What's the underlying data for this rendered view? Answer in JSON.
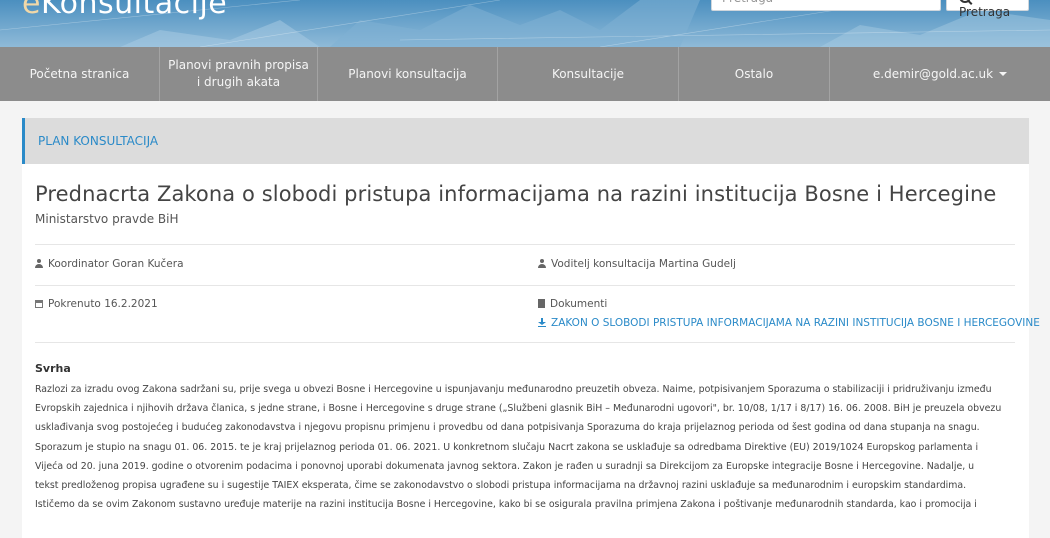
{
  "header": {
    "logo_prefix": "e",
    "logo_main": "Konsultacije",
    "search_placeholder": "Pretraga",
    "search_button": "Pretraga"
  },
  "nav": [
    {
      "label": "Početna stranica"
    },
    {
      "label": "Planovi pravnih propisa i drugih akata"
    },
    {
      "label": "Planovi konsultacija"
    },
    {
      "label": "Konsultacije"
    },
    {
      "label": "Ostalo"
    },
    {
      "label": "e.demir@gold.ac.uk"
    }
  ],
  "card": {
    "section_label": "PLAN KONSULTACIJA",
    "title": "Prednacrta Zakona o slobodi pristupa informacijama na razini institucija Bosne i Hercegine",
    "subtitle": "Ministarstvo pravde BiH",
    "coordinator": "Koordinator Goran Kučera",
    "leader": "Voditelj konsultacija Martina Gudelj",
    "started": "Pokrenuto 16.2.2021",
    "documents_label": "Dokumenti",
    "document_link": "ZAKON O SLOBODI PRISTUPA INFORMACIJAMA NA RAZINI INSTITUCIJA BOSNE I HERCEGOVINE",
    "purpose_heading": "Svrha",
    "purpose_lines": [
      "Razlozi za izradu ovog Zakona sadržani su, prije svega u obvezi Bosne i Hercegovine u ispunjavanju međunarodno preuzetih obveza. Naime, potpisivanjem Sporazuma o stabilizaciji i pridruživanju između",
      "Evropskih zajednica i njihovih država članica, s jedne strane, i Bosne i Hercegovine s druge strane („Službeni glasnik BiH – Međunarodni ugovori\", br. 10/08, 1/17 i 8/17) 16. 06. 2008. BiH je preuzela obvezu",
      "usklađivanja svog postojećeg i budućeg zakonodavstva i njegovu propisnu primjenu i provedbu od dana potpisivanja Sporazuma do kraja prijelaznog perioda od šest godina od dana stupanja na snagu.",
      "Sporazum je stupio na snagu 01. 06. 2015. te je kraj prijelaznog perioda 01. 06. 2021. U konkretnom slučaju Nacrt zakona se usklađuje sa odredbama Direktive (EU) 2019/1024 Europskog parlamenta i",
      "Vijeća od 20. juna 2019. godine o otvorenim podacima i ponovnoj uporabi dokumenata javnog sektora. Zakon je rađen u suradnji sa Direkcijom za Europske integracije Bosne i Hercegovine. Nadalje, u",
      "tekst predloženog propisa ugrađene su i sugestije TAIEX eksperata, čime se zakonodavstvo o slobodi pristupa informacijama na državnoj razini usklađuje sa međunarodnim i europskim standardima.",
      "Ističemo da se ovim Zakonom sustavno uređuje materije na razini institucija Bosne i Hercegovine, kako bi se osigurala pravilna primjena Zakona i poštivanje međunarodnih standarda, kao i promocija i"
    ]
  }
}
